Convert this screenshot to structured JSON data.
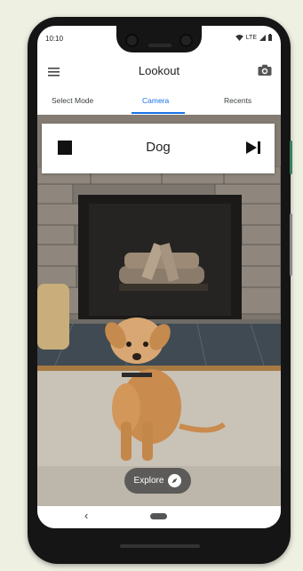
{
  "status_bar": {
    "time": "10:10",
    "network": "LTE"
  },
  "header": {
    "title": "Lookout",
    "menu_icon": "menu-icon",
    "camera_icon": "camera-icon"
  },
  "tabs": [
    {
      "label": "Select Mode",
      "active": false
    },
    {
      "label": "Camera",
      "active": true
    },
    {
      "label": "Recents",
      "active": false
    }
  ],
  "result_card": {
    "label": "Dog",
    "stop_icon": "stop-icon",
    "skip_icon": "skip-next-icon"
  },
  "explore": {
    "label": "Explore",
    "icon": "compass-icon"
  },
  "nav": {
    "back_glyph": "‹"
  },
  "colors": {
    "accent": "#1a73e8",
    "phone_body": "#151515",
    "background": "#eef0e2"
  }
}
